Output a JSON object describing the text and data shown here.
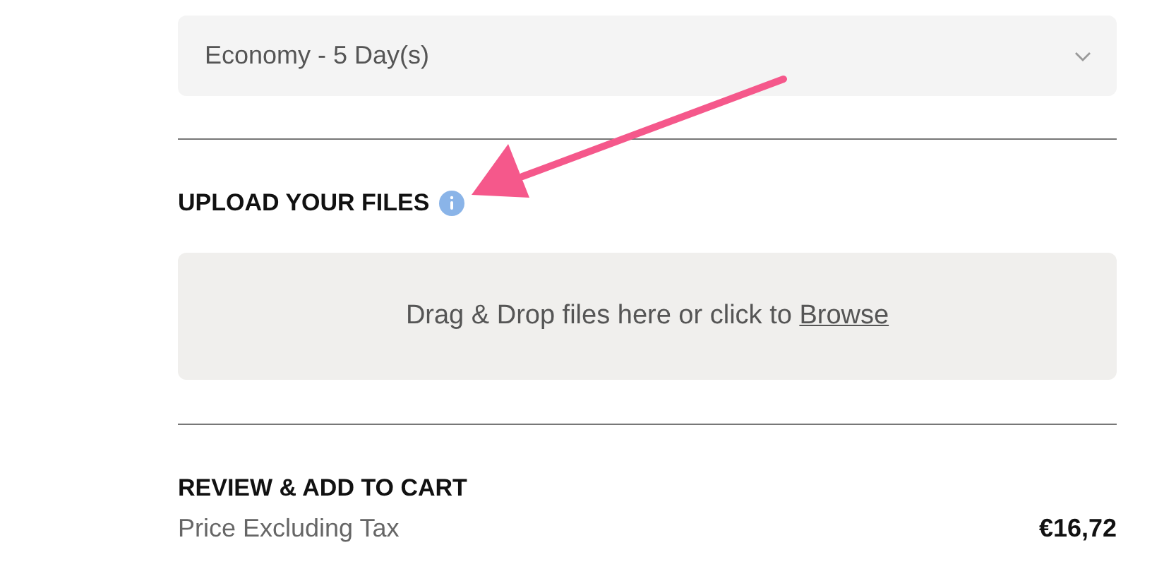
{
  "delivery": {
    "value": "Economy - 5 Day(s)"
  },
  "upload": {
    "heading": "UPLOAD YOUR FILES",
    "dropzone_text": "Drag & Drop files here or click to ",
    "browse_link": "Browse"
  },
  "review": {
    "heading": "REVIEW & ADD TO CART",
    "rows": [
      {
        "label": "Price Excluding Tax",
        "value": "€16,72"
      }
    ]
  }
}
